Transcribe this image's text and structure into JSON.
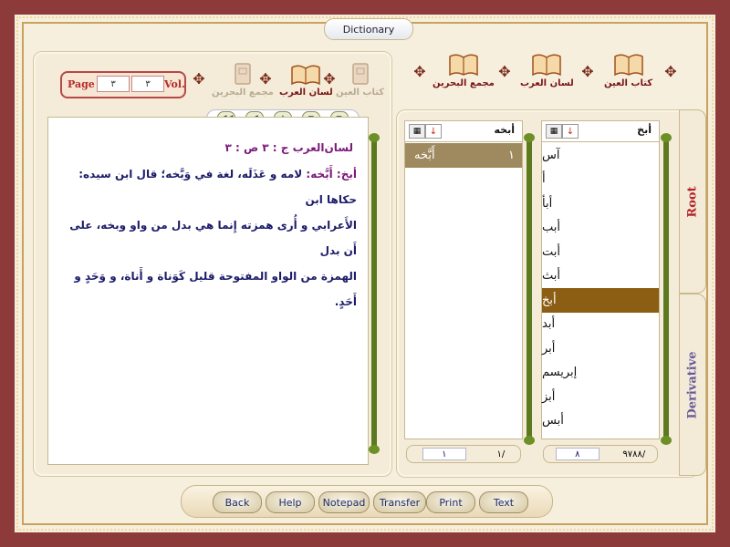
{
  "window": {
    "title": "Dictionary"
  },
  "top_books": [
    {
      "label": "كتاب العين"
    },
    {
      "label": "لسان العرب"
    },
    {
      "label": "مجمع البحرين"
    }
  ],
  "left_books": [
    {
      "label": "كتاب العين",
      "active": false
    },
    {
      "label": "لسان العرب",
      "active": true
    },
    {
      "label": "مجمع البحرين",
      "active": false
    }
  ],
  "page_vol": {
    "page_label": "Page",
    "page_value": "٣",
    "vol_value": "٣",
    "vol_label": "Vol."
  },
  "entry": {
    "header": "لسان‌العرب ج : ٣ ص : ٣",
    "headword": "أبخ:",
    "word": "أَبَّخه:",
    "lines": [
      "لامه و عَذَلَه، لغة في وَبَّخه؛ قال ابن سيده: حكاها ابن",
      "الأَعرابي و أُرى همزته إِنما هي بدل من واو وبخه، على أَن بدل",
      "الهمزة من الواو المفتوحة قليل كَوَناة و أَناة، و وَحَدٍ و أَحَدٍ."
    ]
  },
  "derivative_list": {
    "header_value": "أبخه",
    "items": [
      {
        "word": "أَبَّخه",
        "num": "١"
      }
    ],
    "status": {
      "left": "١",
      "right": "١/"
    }
  },
  "root_list": {
    "header_value": "أبخ",
    "items": [
      "آس",
      "أ",
      "أبأ",
      "أبب",
      "أبت",
      "أبث",
      "أبخ",
      "أبد",
      "أبر",
      "إبريسم",
      "أبز",
      "أبس"
    ],
    "selected_index": 6,
    "status": {
      "left": "٨",
      "right": "٩٧٨٨/"
    }
  },
  "side_tabs": {
    "root": "Root",
    "derivative": "Derivative"
  },
  "toolbar": {
    "back": "Back",
    "help": "Help",
    "notepad": "Notepad",
    "transfer": "Transfer",
    "print": "Print",
    "text": "Text"
  },
  "colors": {
    "frame": "#8c3a3a",
    "selected_row": "#8b5e14",
    "accent_text": "#7a1a7a"
  }
}
